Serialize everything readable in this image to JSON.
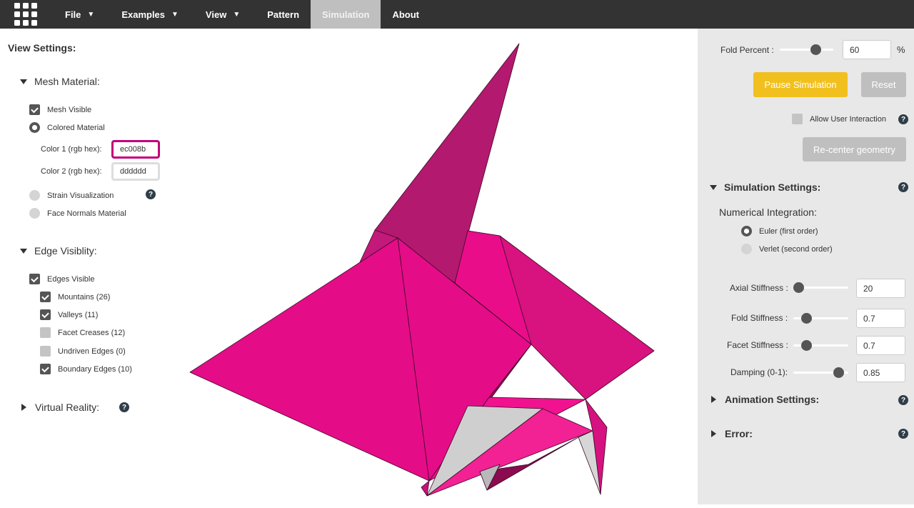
{
  "nav": {
    "file": "File",
    "examples": "Examples",
    "view": "View",
    "pattern": "Pattern",
    "simulation": "Simulation",
    "about": "About"
  },
  "left": {
    "title": "View Settings:",
    "mesh_material": {
      "heading": "Mesh Material:",
      "mesh_visible": "Mesh Visible",
      "colored_material": "Colored Material",
      "color1_label": "Color 1 (rgb hex):",
      "color1_value": "ec008b",
      "color2_label": "Color 2 (rgb hex):",
      "color2_value": "dddddd",
      "strain": "Strain Visualization",
      "face_normals": "Face Normals Material"
    },
    "edge_visibility": {
      "heading": "Edge Visiblity:",
      "edges_visible": "Edges Visible",
      "mountains": "Mountains (26)",
      "valleys": "Valleys (11)",
      "facet_creases": "Facet Creases (12)",
      "undriven": "Undriven Edges (0)",
      "boundary": "Boundary Edges (10)"
    },
    "vr_heading": "Virtual Reality:",
    "help": "?"
  },
  "right": {
    "fold_percent_label": "Fold Percent :",
    "fold_percent_value": "60",
    "fold_percent_unit": "%",
    "fold_percent_fraction": 0.6,
    "pause_button": "Pause Simulation",
    "reset_button": "Reset",
    "allow_interaction": "Allow User Interaction",
    "recenter_button": "Re-center geometry",
    "sim_settings": "Simulation Settings:",
    "numerical_integration": "Numerical Integration:",
    "euler": "Euler (first order)",
    "verlet": "Verlet (second order)",
    "axial_label": "Axial Stiffness :",
    "axial_value": "20",
    "fold_label": "Fold Stiffness :",
    "fold_value": "0.7",
    "facet_label": "Facet Stiffness :",
    "facet_value": "0.7",
    "damping_label": "Damping (0-1):",
    "damping_value": "0.85",
    "animation_settings": "Animation Settings:",
    "error": "Error:",
    "help": "?"
  },
  "colors": {
    "accent_magenta": "#ec008b",
    "pause_button": "#f2c01e",
    "disabled_button": "#bfbfbf",
    "navbar": "#333333"
  }
}
